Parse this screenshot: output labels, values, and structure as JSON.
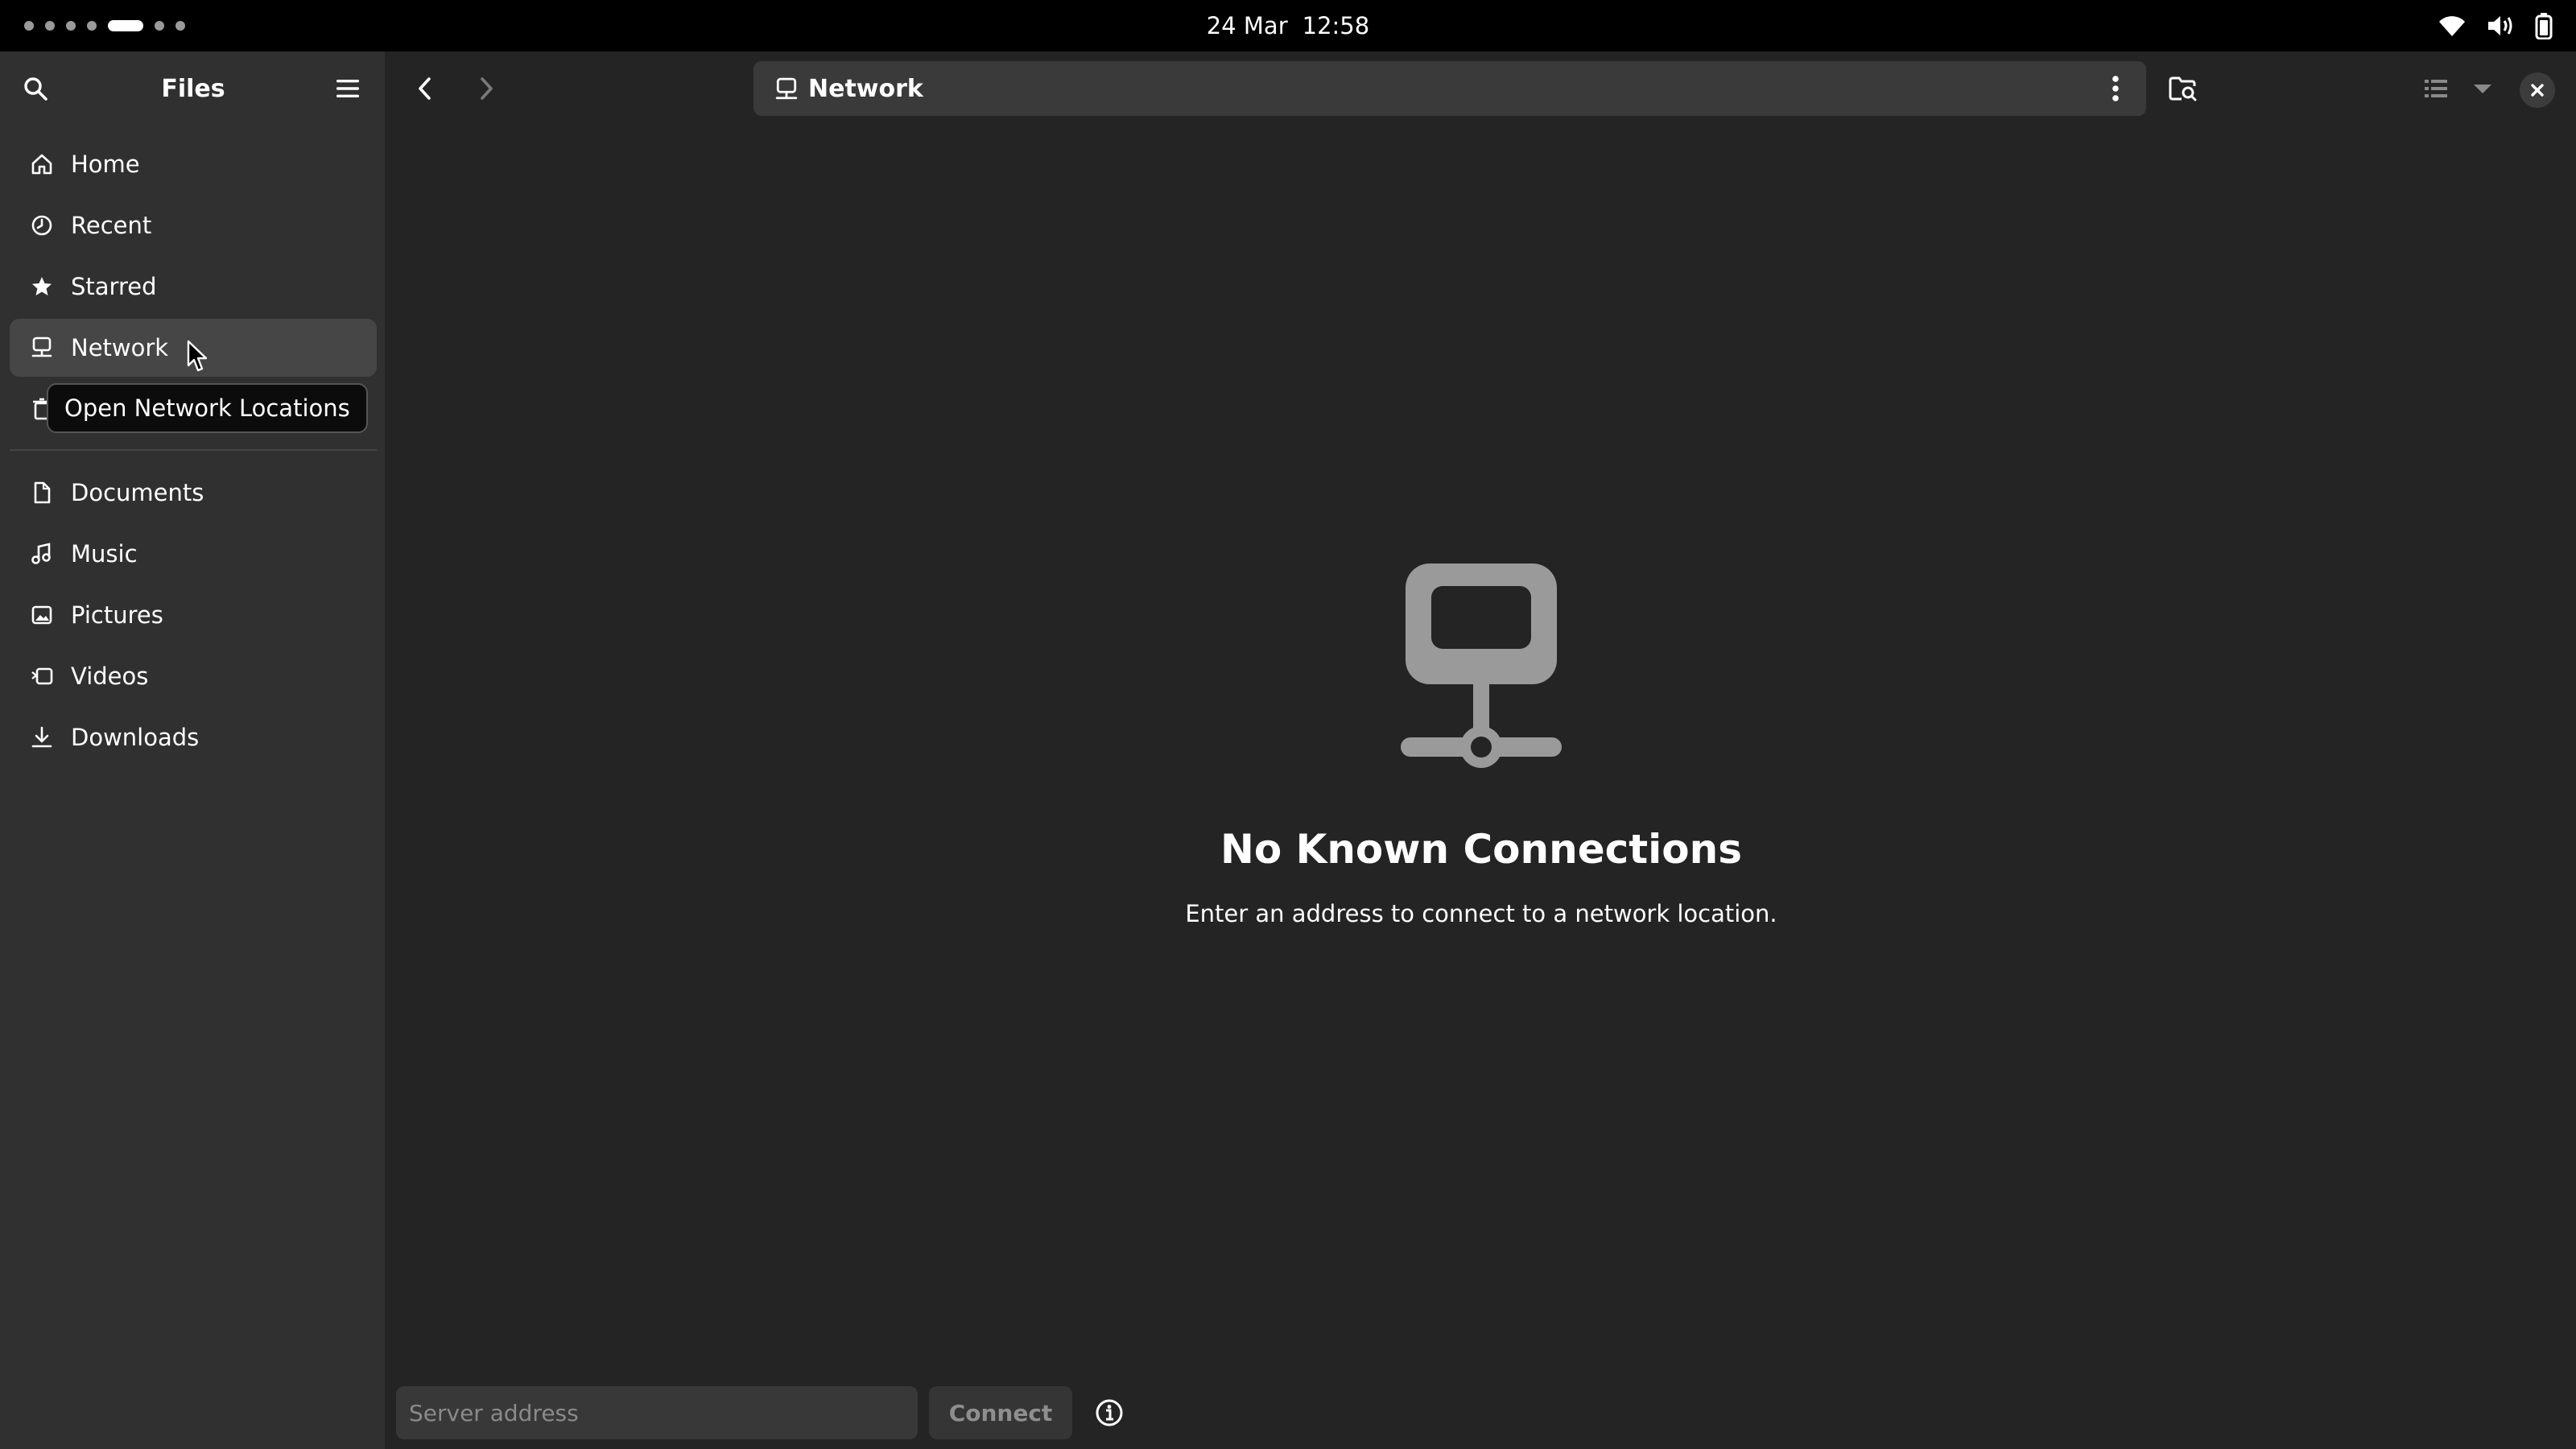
{
  "topbar": {
    "date": "24 Mar",
    "time": "12:58",
    "icons": [
      "wifi-icon",
      "volume-icon",
      "battery-icon"
    ]
  },
  "sidebar": {
    "title": "Files",
    "places": [
      {
        "label": "Home",
        "icon": "home-icon"
      },
      {
        "label": "Recent",
        "icon": "clock-icon"
      },
      {
        "label": "Starred",
        "icon": "star-icon",
        "active": false
      },
      {
        "label": "Network",
        "icon": "network-icon",
        "active": true
      },
      {
        "label": "",
        "icon": "trash-icon"
      }
    ],
    "bookmarks": [
      {
        "label": "Documents",
        "icon": "document-icon"
      },
      {
        "label": "Music",
        "icon": "music-icon"
      },
      {
        "label": "Pictures",
        "icon": "picture-icon"
      },
      {
        "label": "Videos",
        "icon": "video-icon"
      },
      {
        "label": "Downloads",
        "icon": "download-icon"
      }
    ]
  },
  "tooltip": {
    "text": "Open Network Locations"
  },
  "header": {
    "location": "Network",
    "icons": [
      "back-icon",
      "forward-icon",
      "more-icon",
      "search-folder-icon",
      "view-list-icon",
      "dropdown-icon",
      "close-icon"
    ]
  },
  "empty_state": {
    "title": "No Known Connections",
    "description": "Enter an address to connect to a network location."
  },
  "connect_bar": {
    "placeholder": "Server address",
    "value": "",
    "connect_label": "Connect"
  },
  "colors": {
    "window_bg": "#242424",
    "sidebar_bg": "#303030",
    "active_row": "#464646",
    "topbar_bg": "#000000",
    "muted_icon": "#9a9a9a"
  }
}
